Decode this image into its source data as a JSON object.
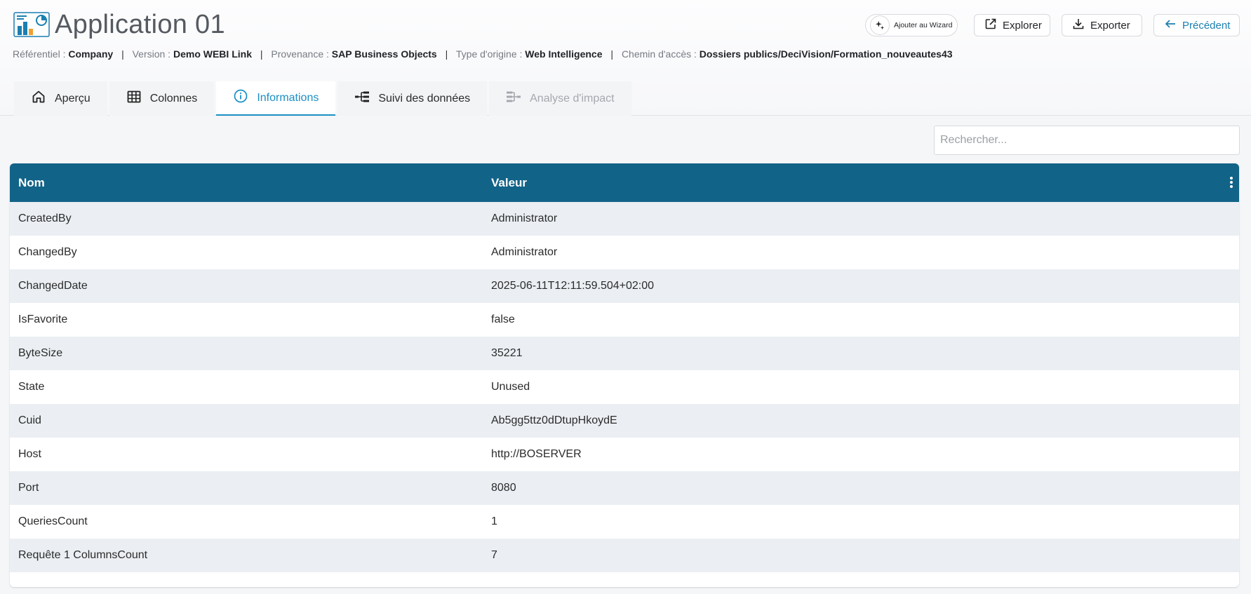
{
  "app": {
    "title": "Application 01",
    "logo_icon": "report-chart-icon"
  },
  "meta": {
    "referentiel_label": "Référentiel :",
    "referentiel_value": "Company",
    "version_label": "Version :",
    "version_value": "Demo WEBI Link",
    "provenance_label": "Provenance :",
    "provenance_value": "SAP Business Objects",
    "type_label": "Type d'origine :",
    "type_value": "Web Intelligence",
    "chemin_label": "Chemin d'accès :",
    "chemin_value": "Dossiers publics/DeciVision/Formation_nouveautes43",
    "separator": "|"
  },
  "actions": {
    "wizard_label": "Ajouter au Wizard",
    "explorer_label": "Explorer",
    "exporter_label": "Exporter",
    "precedent_label": "Précédent"
  },
  "tabs": [
    {
      "label": "Aperçu",
      "icon": "home-icon"
    },
    {
      "label": "Colonnes",
      "icon": "table-grid-icon"
    },
    {
      "label": "Informations",
      "icon": "info-icon",
      "active": true
    },
    {
      "label": "Suivi des données",
      "icon": "lineage-tree-icon"
    },
    {
      "label": "Analyse d'impact",
      "icon": "impact-analysis-icon",
      "disabled": true
    }
  ],
  "search": {
    "placeholder": "Rechercher..."
  },
  "table": {
    "headers": [
      "Nom",
      "Valeur"
    ],
    "rows": [
      [
        "CreatedBy",
        "Administrator"
      ],
      [
        "ChangedBy",
        "Administrator"
      ],
      [
        "ChangedDate",
        "2025-06-11T12:11:59.504+02:00"
      ],
      [
        "IsFavorite",
        "false"
      ],
      [
        "ByteSize",
        "35221"
      ],
      [
        "State",
        "Unused"
      ],
      [
        "Cuid",
        "Ab5gg5ttz0dDtupHkoydE"
      ],
      [
        "Host",
        "http://BOSERVER"
      ],
      [
        "Port",
        "8080"
      ],
      [
        "QueriesCount",
        "1"
      ],
      [
        "Requête 1 ColumnsCount",
        "7"
      ]
    ]
  },
  "colors": {
    "header_bg": "#126388",
    "accent": "#1b8fc4",
    "row_alt": "#ebeff3"
  }
}
